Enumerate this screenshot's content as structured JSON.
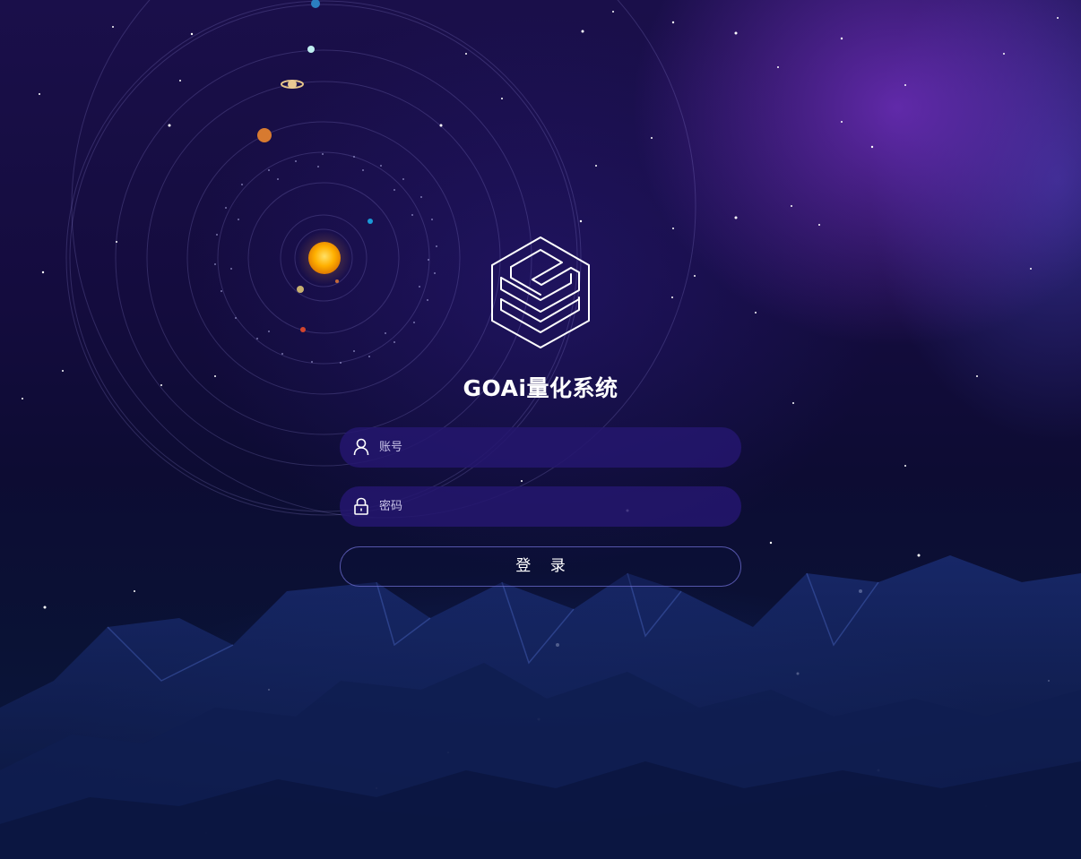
{
  "app": {
    "title": "GOAi量化系统",
    "logo_icon": "cube-logo-icon"
  },
  "form": {
    "username": {
      "placeholder": "账号",
      "value": "",
      "icon": "user-icon"
    },
    "password": {
      "placeholder": "密码",
      "value": "",
      "icon": "lock-icon"
    },
    "submit_label": "登 录"
  },
  "colors": {
    "field_background": "#24166e",
    "button_border": "#6e6ed2",
    "sun": "#f7a600",
    "text": "#ffffff"
  }
}
